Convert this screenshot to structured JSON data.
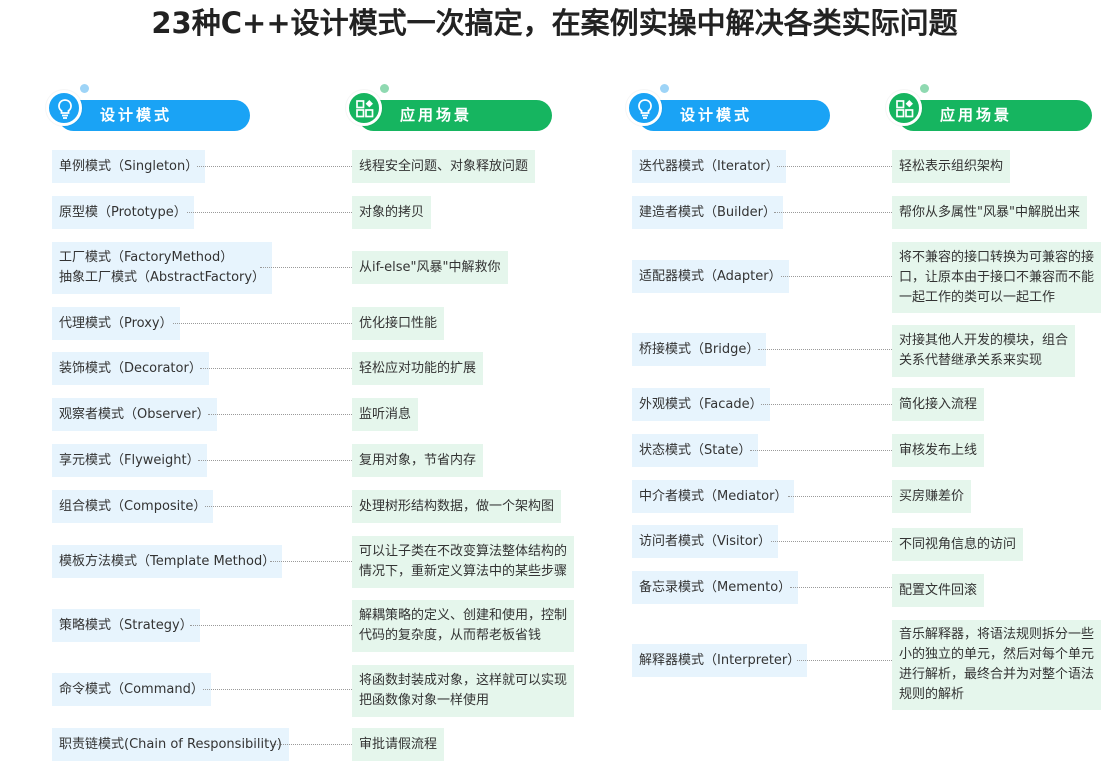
{
  "title": "23种C++设计模式一次搞定，在案例实操中解决各类实际问题",
  "headers": {
    "pattern": "设计模式",
    "scenario": "应用场景"
  },
  "colors": {
    "blue": "#1aa3f5",
    "green": "#16b560",
    "pattern_bg": "#e7f4fd",
    "scenario_bg": "#e5f6ec"
  },
  "icons": {
    "pattern_header": "lightbulb-icon",
    "scenario_header": "app-grid-icon"
  },
  "left_column": [
    {
      "pattern": "单例模式（Singleton）",
      "scenario": "线程安全问题、对象释放问题"
    },
    {
      "pattern": "原型模（Prototype）",
      "scenario": "对象的拷贝"
    },
    {
      "pattern": "工厂模式（FactoryMethod）",
      "pattern2": "抽象工厂模式（AbstractFactory）",
      "scenario": "从if-else\"风暴\"中解救你"
    },
    {
      "pattern": "代理模式（Proxy）",
      "scenario": "优化接口性能"
    },
    {
      "pattern": "装饰模式（Decorator）",
      "scenario": "轻松应对功能的扩展"
    },
    {
      "pattern": "观察者模式（Observer）",
      "scenario": "监听消息"
    },
    {
      "pattern": "享元模式（Flyweight）",
      "scenario": "复用对象，节省内存"
    },
    {
      "pattern": "组合模式（Composite）",
      "scenario": "处理树形结构数据，做一个架构图"
    },
    {
      "pattern": "模板方法模式（Template Method）",
      "scenario": "可以让子类在不改变算法整体结构的",
      "scenario2": "情况下，重新定义算法中的某些步骤"
    },
    {
      "pattern": "策略模式（Strategy）",
      "scenario": "解耦策略的定义、创建和使用，控制",
      "scenario2": "代码的复杂度，从而帮老板省钱"
    },
    {
      "pattern": "命令模式（Command）",
      "scenario": "将函数封装成对象，这样就可以实现",
      "scenario2": "把函数像对象一样使用"
    },
    {
      "pattern": "职责链模式(Chain of Responsibility)",
      "scenario": "审批请假流程"
    }
  ],
  "right_column": [
    {
      "pattern": "迭代器模式（Iterator）",
      "scenario": "轻松表示组织架构"
    },
    {
      "pattern": "建造者模式（Builder）",
      "scenario": "帮你从多属性\"风暴\"中解脱出来"
    },
    {
      "pattern": "适配器模式（Adapter）",
      "scenario": "将不兼容的接口转换为可兼容的接",
      "scenario2": "口，让原本由于接口不兼容而不能",
      "scenario3": "一起工作的类可以一起工作"
    },
    {
      "pattern": "桥接模式（Bridge）",
      "scenario": "对接其他人开发的模块，组合",
      "scenario2": "关系代替继承关系来实现"
    },
    {
      "pattern": "外观模式（Facade）",
      "scenario": "简化接入流程"
    },
    {
      "pattern": "状态模式（State）",
      "scenario": "审核发布上线"
    },
    {
      "pattern": "中介者模式（Mediator）",
      "scenario": "买房赚差价"
    },
    {
      "pattern": "访问者模式（Visitor）",
      "scenario": "不同视角信息的访问"
    },
    {
      "pattern": "备忘录模式（Memento）",
      "scenario": "配置文件回滚"
    },
    {
      "pattern": "解释器模式（Interpreter）",
      "scenario": "音乐解释器，将语法规则拆分一些",
      "scenario2": "小的独立的单元，然后对每个单元",
      "scenario3": "进行解析，最终合并为对整个语法",
      "scenario4": "规则的解析"
    }
  ]
}
